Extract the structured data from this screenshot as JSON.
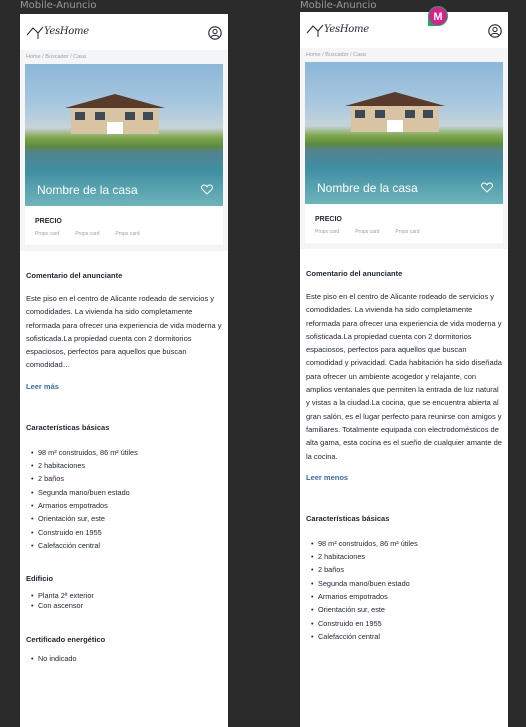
{
  "frames": [
    {
      "label": "Mobile-Anuncio"
    },
    {
      "label": "Mobile-Anuncio"
    }
  ],
  "brand": {
    "logo_text": "YesHome"
  },
  "breadcrumb": [
    "Home",
    "/",
    "Buscador",
    "/",
    "Casa"
  ],
  "listing": {
    "title": "Nombre de la casa",
    "price": "PRECIO",
    "props": [
      "Props card",
      "Props card",
      "Props card"
    ]
  },
  "comment": {
    "heading": "Comentario del anunciante",
    "short_text": "Este piso en el centro de Alicante rodeado de servicios y comodidades. La vivienda ha sido completamente reformada para ofrecer una experiencia de vida moderna y sofisticada.La propiedad cuenta con 2 dormitorios espaciosos, perfectos para aquellos que buscan comodidad…",
    "full_text": "Este piso en el centro de Alicante rodeado de servicios y comodidades. La vivienda ha sido completamente reformada para ofrecer una experiencia de vida moderna y sofisticada.La propiedad cuenta con 2 dormitorios espaciosos, perfectos para aquellos que buscan comodidad y privacidad. Cada habitación ha sido diseñada para ofrecer un ambiente acogedor y relajante, con amplios ventanales que permiten la entrada de luz natural y vistas a la ciudad.La cocina, que se encuentra abierta al gran salón, es el lugar perfecto para reunirse con amigos y familiares. Totalmente equipada con electrodomésticos de alta gama, esta cocina es el sueño de cualquier amante de la cocina.",
    "more_label": "Leer más",
    "less_label": "Leer menos"
  },
  "features": {
    "heading": "Características básicas",
    "items": [
      "98 m² construidos, 86 m² útiles",
      "2 habitaciones",
      "2 baños",
      "Segunda mano/buen estado",
      "Armarios empotrados",
      "Orientación sur, este",
      "Construido en 1955",
      "Calefacción central"
    ]
  },
  "building": {
    "heading": "Edificio",
    "items": [
      "Planta 2ª exterior",
      "Con ascensor"
    ]
  },
  "energy": {
    "heading": "Certificado energético",
    "items": [
      "No indicado"
    ]
  },
  "avatar": {
    "initial": "M",
    "color": "#d6228a",
    "ring": "#1fa567"
  }
}
